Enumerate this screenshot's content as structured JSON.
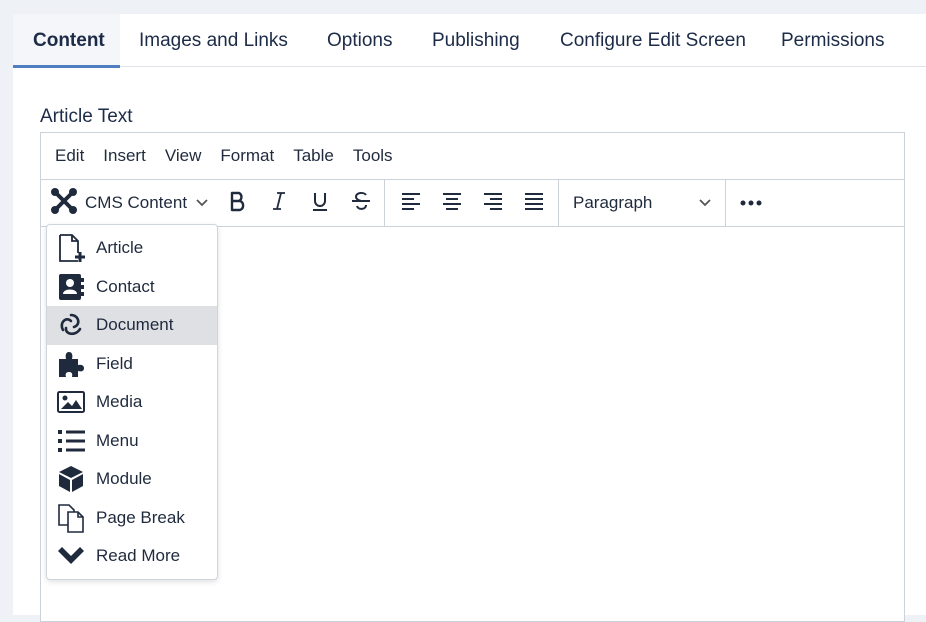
{
  "tabs": [
    {
      "label": "Content",
      "active": true
    },
    {
      "label": "Images and Links"
    },
    {
      "label": "Options"
    },
    {
      "label": "Publishing"
    },
    {
      "label": "Configure Edit Screen"
    },
    {
      "label": "Permissions"
    }
  ],
  "field": {
    "label": "Article Text"
  },
  "menubar": [
    "Edit",
    "Insert",
    "View",
    "Format",
    "Table",
    "Tools"
  ],
  "toolbar": {
    "cms_label": "CMS Content",
    "block_format": "Paragraph",
    "icons": [
      "joomla-icon",
      "bold-icon",
      "italic-icon",
      "underline-icon",
      "strikethrough-icon",
      "align-left-icon",
      "align-center-icon",
      "align-right-icon",
      "justify-icon",
      "more-icon"
    ]
  },
  "dropdown": {
    "items": [
      {
        "label": "Article",
        "icon": "file-plus-icon"
      },
      {
        "label": "Contact",
        "icon": "address-book-icon"
      },
      {
        "label": "Document",
        "icon": "document-swirl-icon",
        "hover": true
      },
      {
        "label": "Field",
        "icon": "puzzle-piece-icon"
      },
      {
        "label": "Media",
        "icon": "image-icon"
      },
      {
        "label": "Menu",
        "icon": "list-icon"
      },
      {
        "label": "Module",
        "icon": "cube-icon"
      },
      {
        "label": "Page Break",
        "icon": "copy-icon"
      },
      {
        "label": "Read More",
        "icon": "chevron-down-icon"
      }
    ]
  },
  "colors": {
    "accent": "#4f7fc0",
    "text": "#1c2b47",
    "hover": "#dee0e3"
  }
}
